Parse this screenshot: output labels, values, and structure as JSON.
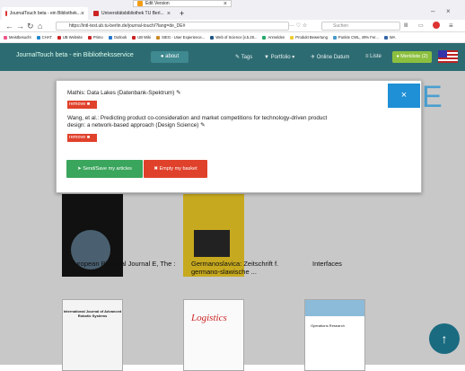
{
  "browser": {
    "tabs": [
      {
        "label": "JournalTouch beta - ein Bibliothek..."
      },
      {
        "label": "Universitätsbibliothek TU Berl..."
      },
      {
        "label": "Edit Version"
      }
    ],
    "new_tab": "+",
    "url": "https://intl-test.ub.tu-berlin.de/journal-touch/?lang=de_DE#",
    "search_placeholder": "Suchen",
    "page_actions": "··· ♡ ☆",
    "bookmarks": [
      "Meistbesucht",
      "CHAT",
      "UB Website",
      "Primo",
      "Outlook",
      "UB Wiki",
      "SIEG - User Experience...",
      "Web of Science [v.5.28...",
      "Anmelden",
      "Produkt Bewertung",
      "Punkte CWL, 49% Fer...",
      "WA"
    ]
  },
  "app": {
    "brand": "JournalTouch beta - ein Bibliotheksservice",
    "about": "about",
    "tags": "Tags",
    "portfolio": "Portfolio",
    "online_date": "Online Datum",
    "list": "Liste",
    "basket": "Merkliste (2)",
    "partial_letter": "E"
  },
  "journals": [
    {
      "title": "European Physical Journal E, The : Soft Matter and ..."
    },
    {
      "title": "Germanoslavica: Zeitschrift f. germano-slawische ..."
    },
    {
      "title": "Interfaces"
    },
    {
      "title": "International Journal of Advanced Robotic Systems"
    },
    {
      "title": "Logistics"
    },
    {
      "title": "Operations Research"
    }
  ],
  "modal": {
    "items": [
      {
        "title": "Mathis: Data Lakes (Datenbank-Spektrum)",
        "remove": "remove"
      },
      {
        "title": "Wang, et al.: Predicting product co-consideration and market competitions for technology-driven product design: a network-based approach (Design Science)",
        "remove": "remove"
      }
    ],
    "send_label": "➤ Send/Save my articles",
    "empty_label": "✖ Empty my basket",
    "close": "×"
  },
  "scroll_top": "↑",
  "colors": {
    "nav": "#2d6b72",
    "remove": "#e0412b",
    "send": "#3aa55c",
    "empty": "#e0412b",
    "close": "#1f8fd6"
  }
}
